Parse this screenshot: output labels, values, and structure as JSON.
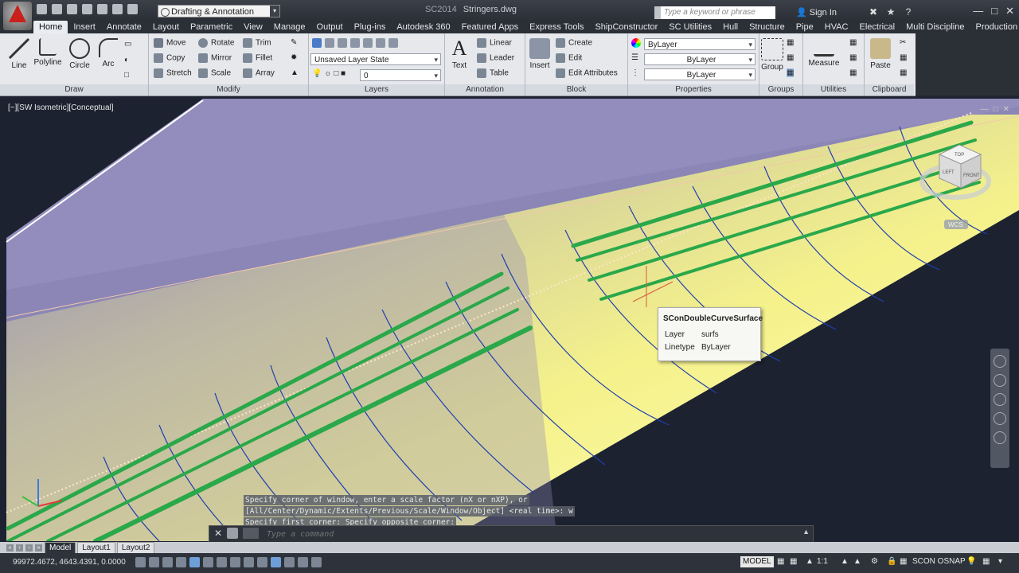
{
  "app": {
    "workspace": "Drafting & Annotation",
    "title_prefix": "SC2014",
    "file_name": "Stringers.dwg",
    "search_placeholder": "Type a keyword or phrase",
    "sign_in": "Sign In"
  },
  "tabs": [
    "Home",
    "Insert",
    "Annotate",
    "Layout",
    "Parametric",
    "View",
    "Manage",
    "Output",
    "Plug-ins",
    "Autodesk 360",
    "Featured Apps",
    "Express Tools",
    "ShipConstructor",
    "SC Utilities",
    "Hull",
    "Structure",
    "Pipe",
    "HVAC",
    "Electrical",
    "Multi Discipline",
    "Production"
  ],
  "ribbon": {
    "draw": {
      "title": "Draw",
      "line": "Line",
      "polyline": "Polyline",
      "circle": "Circle",
      "arc": "Arc"
    },
    "modify": {
      "title": "Modify",
      "move": "Move",
      "rotate": "Rotate",
      "trim": "Trim",
      "copy": "Copy",
      "mirror": "Mirror",
      "fillet": "Fillet",
      "stretch": "Stretch",
      "scale": "Scale",
      "array": "Array"
    },
    "layers": {
      "title": "Layers",
      "layer_state": "Unsaved Layer State",
      "current_layer": "0"
    },
    "annotation": {
      "title": "Annotation",
      "text": "Text",
      "linear": "Linear",
      "leader": "Leader",
      "table": "Table"
    },
    "block": {
      "title": "Block",
      "insert": "Insert",
      "create": "Create",
      "edit": "Edit",
      "edit_attributes": "Edit Attributes"
    },
    "properties": {
      "title": "Properties",
      "color": "ByLayer",
      "linetype": "ByLayer",
      "lineweight": "ByLayer"
    },
    "groups": {
      "title": "Groups",
      "group": "Group"
    },
    "utilities": {
      "title": "Utilities",
      "measure": "Measure"
    },
    "clipboard": {
      "title": "Clipboard",
      "paste": "Paste"
    }
  },
  "viewport": {
    "label": "[−][SW Isometric][Conceptual]",
    "tooltip": {
      "title": "SConDoubleCurveSurface",
      "layer_key": "Layer",
      "layer_val": "surfs",
      "linetype_key": "Linetype",
      "linetype_val": "ByLayer"
    },
    "viewcube": {
      "top": "TOP",
      "left": "LEFT",
      "front": "FRONT",
      "wcs": "WCS"
    }
  },
  "command": {
    "history": [
      "Specify corner of window, enter a scale factor (nX or nXP), or",
      "[All/Center/Dynamic/Extents/Previous/Scale/Window/Object] <real time>: w",
      "Specify first corner: Specify opposite corner:"
    ],
    "placeholder": "Type a command"
  },
  "layout_tabs": [
    "Model",
    "Layout1",
    "Layout2"
  ],
  "status": {
    "coords": "99972.4672, 4643.4391, 0.0000",
    "model": "MODEL",
    "scale": "1:1",
    "osnap": "SCON OSNAP"
  },
  "colors": {
    "hull_surface": "#f2f08a",
    "stringer": "#2aa84a",
    "frame_line": "#1f3fb0",
    "background_plate": "#8e88b8"
  }
}
